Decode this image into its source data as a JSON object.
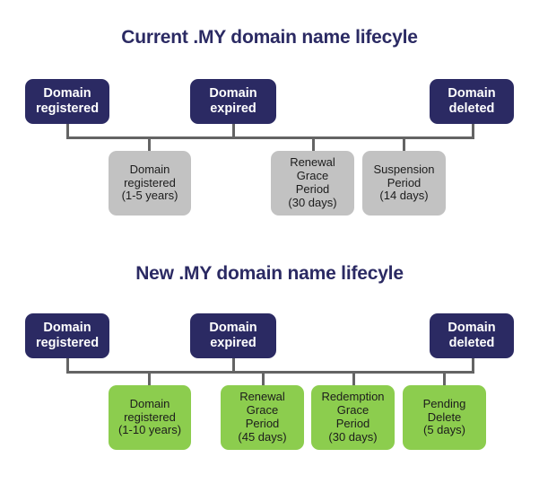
{
  "diagram": {
    "title_current": "Current .MY domain name lifecyle",
    "title_new": "New .MY domain name lifecyle",
    "colors": {
      "event_box": "#2b2a63",
      "phase_grey": "#c2c2c2",
      "phase_green": "#8ccd4e",
      "connector": "#646464",
      "title_text": "#2b2a63",
      "background": "#ffffff"
    }
  },
  "current_lifecycle": {
    "events": [
      {
        "label": "Domain\nregistered"
      },
      {
        "label": "Domain\nexpired"
      },
      {
        "label": "Domain\ndeleted"
      }
    ],
    "phases": [
      {
        "name": "Domain registered",
        "duration": "(1-5 years)",
        "label": "Domain\nregistered\n(1-5 years)"
      },
      {
        "name": "Renewal Grace Period",
        "duration": "(30 days)",
        "label": "Renewal\nGrace\nPeriod\n(30 days)"
      },
      {
        "name": "Suspension Period",
        "duration": "(14 days)",
        "label": "Suspension\nPeriod\n(14 days)"
      }
    ]
  },
  "new_lifecycle": {
    "events": [
      {
        "label": "Domain\nregistered"
      },
      {
        "label": "Domain\nexpired"
      },
      {
        "label": "Domain\ndeleted"
      }
    ],
    "phases": [
      {
        "name": "Domain registered",
        "duration": "(1-10 years)",
        "label": "Domain\nregistered\n(1-10 years)"
      },
      {
        "name": "Renewal Grace Period",
        "duration": "(45 days)",
        "label": "Renewal\nGrace\nPeriod\n(45 days)"
      },
      {
        "name": "Redemption Grace Period",
        "duration": "(30 days)",
        "label": "Redemption\nGrace\nPeriod\n(30 days)"
      },
      {
        "name": "Pending Delete",
        "duration": "(5 days)",
        "label": "Pending\nDelete\n(5 days)"
      }
    ]
  }
}
